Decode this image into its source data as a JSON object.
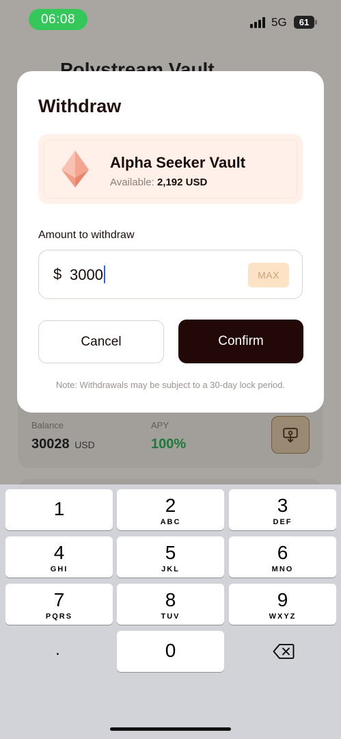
{
  "status_bar": {
    "time": "06:08",
    "network": "5G",
    "battery": "61"
  },
  "background": {
    "title": "Polystream Vault",
    "balance_label": "Balance",
    "balance_value": "30028",
    "balance_unit": "USD",
    "apy_label": "APY",
    "apy_value": "100%"
  },
  "modal": {
    "title": "Withdraw",
    "vault": {
      "name": "Alpha Seeker Vault",
      "available_label": "Available:",
      "available_value": "2,192 USD"
    },
    "amount_label": "Amount to withdraw",
    "currency_symbol": "$",
    "amount_value": "3000",
    "max_label": "MAX",
    "cancel_label": "Cancel",
    "confirm_label": "Confirm",
    "note": "Note: Withdrawals may be subject to a 30-day lock period."
  },
  "keyboard": {
    "keys": [
      {
        "digit": "1",
        "letters": ""
      },
      {
        "digit": "2",
        "letters": "ABC"
      },
      {
        "digit": "3",
        "letters": "DEF"
      },
      {
        "digit": "4",
        "letters": "GHI"
      },
      {
        "digit": "5",
        "letters": "JKL"
      },
      {
        "digit": "6",
        "letters": "MNO"
      },
      {
        "digit": "7",
        "letters": "PQRS"
      },
      {
        "digit": "8",
        "letters": "TUV"
      },
      {
        "digit": "9",
        "letters": "WXYZ"
      },
      {
        "digit": "0",
        "letters": ""
      }
    ],
    "decimal": "."
  },
  "colors": {
    "status_green": "#34c759",
    "confirm_bg": "#220806",
    "vault_card_bg": "#fff1ea",
    "max_bg": "#fde3c6",
    "apy_green": "#1e7a3a",
    "caret": "#2f62e0"
  },
  "icons": {
    "back": "arrow-left-icon",
    "vault": "ethereum-icon",
    "withdraw": "withdraw-icon",
    "delete": "backspace-icon"
  }
}
